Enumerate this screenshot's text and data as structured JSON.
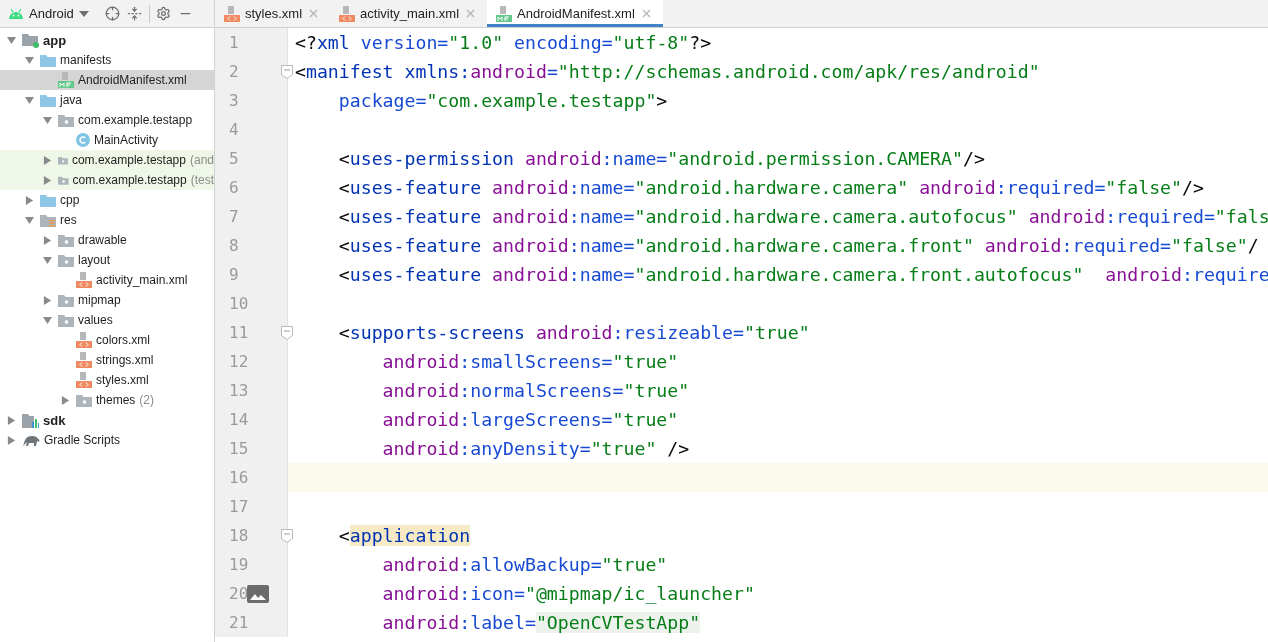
{
  "project_panel": {
    "view": {
      "label": "Android"
    },
    "items": [
      {
        "label": "app",
        "kind": "module",
        "bold": true,
        "expanded": true,
        "selected": false,
        "tinted": false,
        "children": [
          {
            "label": "manifests",
            "kind": "folder",
            "expanded": true,
            "selected": false,
            "tinted": false,
            "children": [
              {
                "label": "AndroidManifest.xml",
                "kind": "manifest",
                "selected": true,
                "tinted": false
              }
            ]
          },
          {
            "label": "java",
            "kind": "folder",
            "expanded": true,
            "selected": false,
            "tinted": false,
            "children": [
              {
                "label": "com.example.testapp",
                "kind": "package",
                "expanded": true,
                "selected": false,
                "tinted": false,
                "children": [
                  {
                    "label": "MainActivity",
                    "kind": "class",
                    "selected": false,
                    "tinted": false
                  }
                ]
              },
              {
                "label": "com.example.testapp",
                "suffix": "(and",
                "kind": "package",
                "expanded": false,
                "selected": false,
                "tinted": true
              },
              {
                "label": "com.example.testapp",
                "suffix": "(test",
                "kind": "package",
                "expanded": false,
                "selected": false,
                "tinted": true
              }
            ]
          },
          {
            "label": "cpp",
            "kind": "folder",
            "expanded": false,
            "selected": false,
            "tinted": false
          },
          {
            "label": "res",
            "kind": "res",
            "expanded": true,
            "selected": false,
            "tinted": false,
            "children": [
              {
                "label": "drawable",
                "kind": "package",
                "expanded": false,
                "selected": false,
                "tinted": false
              },
              {
                "label": "layout",
                "kind": "package",
                "expanded": true,
                "selected": false,
                "tinted": false,
                "children": [
                  {
                    "label": "activity_main.xml",
                    "kind": "xml",
                    "selected": false,
                    "tinted": false
                  }
                ]
              },
              {
                "label": "mipmap",
                "kind": "package",
                "expanded": false,
                "selected": false,
                "tinted": false
              },
              {
                "label": "values",
                "kind": "package",
                "expanded": true,
                "selected": false,
                "tinted": false,
                "children": [
                  {
                    "label": "colors.xml",
                    "kind": "xml",
                    "selected": false,
                    "tinted": false
                  },
                  {
                    "label": "strings.xml",
                    "kind": "xml",
                    "selected": false,
                    "tinted": false
                  },
                  {
                    "label": "styles.xml",
                    "kind": "xml",
                    "selected": false,
                    "tinted": false
                  },
                  {
                    "label": "themes",
                    "suffix": "(2)",
                    "kind": "package",
                    "expanded": false,
                    "selected": false,
                    "tinted": false
                  }
                ]
              }
            ]
          }
        ]
      },
      {
        "label": "sdk",
        "kind": "sdk",
        "bold": true,
        "expanded": false,
        "selected": false,
        "tinted": false
      },
      {
        "label": "Gradle Scripts",
        "kind": "gradle",
        "expanded": false,
        "selected": false,
        "tinted": false
      }
    ]
  },
  "tabs": [
    {
      "label": "styles.xml",
      "kind": "xml",
      "selected": false
    },
    {
      "label": "activity_main.xml",
      "kind": "xml",
      "selected": false
    },
    {
      "label": "AndroidManifest.xml",
      "kind": "manifest",
      "selected": true
    }
  ],
  "editor": {
    "lines": [
      {
        "number": "1",
        "kind": "plain",
        "tokens": [
          {
            "kind": "punct",
            "text": "<?"
          },
          {
            "kind": "tag",
            "text": "xml"
          },
          {
            "kind": "attr",
            "text": " version="
          },
          {
            "kind": "value",
            "text": "\"1.0\""
          },
          {
            "kind": "attr",
            "text": " encoding="
          },
          {
            "kind": "value",
            "text": "\"utf-8\""
          },
          {
            "kind": "punct",
            "text": "?>"
          }
        ]
      },
      {
        "number": "2",
        "kind": "fold",
        "tokens": [
          {
            "kind": "punct",
            "text": "<"
          },
          {
            "kind": "tag",
            "text": "manifest"
          },
          {
            "kind": "tag",
            "text": " xmlns:"
          },
          {
            "kind": "ns",
            "text": "android"
          },
          {
            "kind": "attr",
            "text": "="
          },
          {
            "kind": "value",
            "text": "\"http://schemas.android.com/apk/res/android\""
          }
        ]
      },
      {
        "number": "3",
        "kind": "plain",
        "tokens": [
          {
            "kind": "attr",
            "text": "    package="
          },
          {
            "kind": "value",
            "text": "\"com.example.testapp\""
          },
          {
            "kind": "punct",
            "text": ">"
          }
        ]
      },
      {
        "number": "4",
        "kind": "plain"
      },
      {
        "number": "5",
        "kind": "plain",
        "tokens": [
          {
            "kind": "punct",
            "text": "    <"
          },
          {
            "kind": "tag",
            "text": "uses-permission"
          },
          {
            "kind": "ns",
            "text": " android"
          },
          {
            "kind": "attr",
            "text": ":name="
          },
          {
            "kind": "value",
            "text": "\"android.permission.CAMERA\""
          },
          {
            "kind": "punct",
            "text": "/>"
          }
        ]
      },
      {
        "number": "6",
        "kind": "plain",
        "tokens": [
          {
            "kind": "punct",
            "text": "    <"
          },
          {
            "kind": "tag",
            "text": "uses-feature"
          },
          {
            "kind": "ns",
            "text": " android"
          },
          {
            "kind": "attr",
            "text": ":name="
          },
          {
            "kind": "value",
            "text": "\"android.hardware.camera\""
          },
          {
            "kind": "ns",
            "text": " android"
          },
          {
            "kind": "attr",
            "text": ":required="
          },
          {
            "kind": "value",
            "text": "\"false\""
          },
          {
            "kind": "punct",
            "text": "/>"
          }
        ]
      },
      {
        "number": "7",
        "kind": "plain",
        "tokens": [
          {
            "kind": "punct",
            "text": "    <"
          },
          {
            "kind": "tag",
            "text": "uses-feature"
          },
          {
            "kind": "ns",
            "text": " android"
          },
          {
            "kind": "attr",
            "text": ":name="
          },
          {
            "kind": "value",
            "text": "\"android.hardware.camera.autofocus\""
          },
          {
            "kind": "ns",
            "text": " android"
          },
          {
            "kind": "attr",
            "text": ":required="
          },
          {
            "kind": "value",
            "text": "\"fals"
          }
        ]
      },
      {
        "number": "8",
        "kind": "plain",
        "tokens": [
          {
            "kind": "punct",
            "text": "    <"
          },
          {
            "kind": "tag",
            "text": "uses-feature"
          },
          {
            "kind": "ns",
            "text": " android"
          },
          {
            "kind": "attr",
            "text": ":name="
          },
          {
            "kind": "value",
            "text": "\"android.hardware.camera.front\""
          },
          {
            "kind": "ns",
            "text": " android"
          },
          {
            "kind": "attr",
            "text": ":required="
          },
          {
            "kind": "value",
            "text": "\"false\""
          },
          {
            "kind": "punct",
            "text": "/"
          }
        ]
      },
      {
        "number": "9",
        "kind": "plain",
        "tokens": [
          {
            "kind": "punct",
            "text": "    <"
          },
          {
            "kind": "tag",
            "text": "uses-feature"
          },
          {
            "kind": "ns",
            "text": " android"
          },
          {
            "kind": "attr",
            "text": ":name="
          },
          {
            "kind": "value",
            "text": "\"android.hardware.camera.front.autofocus\""
          },
          {
            "kind": "ns",
            "text": "  android"
          },
          {
            "kind": "attr",
            "text": ":require"
          }
        ]
      },
      {
        "number": "10",
        "kind": "plain"
      },
      {
        "number": "11",
        "kind": "fold",
        "tokens": [
          {
            "kind": "punct",
            "text": "    <"
          },
          {
            "kind": "tag",
            "text": "supports-screens"
          },
          {
            "kind": "ns",
            "text": " android"
          },
          {
            "kind": "attr",
            "text": ":resizeable="
          },
          {
            "kind": "value",
            "text": "\"true\""
          }
        ]
      },
      {
        "number": "12",
        "kind": "plain",
        "tokens": [
          {
            "kind": "ns",
            "text": "        android"
          },
          {
            "kind": "attr",
            "text": ":smallScreens="
          },
          {
            "kind": "value",
            "text": "\"true\""
          }
        ]
      },
      {
        "number": "13",
        "kind": "plain",
        "tokens": [
          {
            "kind": "ns",
            "text": "        android"
          },
          {
            "kind": "attr",
            "text": ":normalScreens="
          },
          {
            "kind": "value",
            "text": "\"true\""
          }
        ]
      },
      {
        "number": "14",
        "kind": "plain",
        "tokens": [
          {
            "kind": "ns",
            "text": "        android"
          },
          {
            "kind": "attr",
            "text": ":largeScreens="
          },
          {
            "kind": "value",
            "text": "\"true\""
          }
        ]
      },
      {
        "number": "15",
        "kind": "plain",
        "tokens": [
          {
            "kind": "ns",
            "text": "        android"
          },
          {
            "kind": "attr",
            "text": ":anyDensity="
          },
          {
            "kind": "value",
            "text": "\"true\""
          },
          {
            "kind": "punct",
            "text": " />"
          }
        ]
      },
      {
        "number": "16",
        "kind": "plain",
        "current": true
      },
      {
        "number": "17",
        "kind": "plain"
      },
      {
        "number": "18",
        "kind": "fold",
        "tokens": [
          {
            "kind": "punct",
            "text": "    <"
          },
          {
            "kind": "tag",
            "text": "application",
            "highlighted": true
          }
        ]
      },
      {
        "number": "19",
        "kind": "plain",
        "tokens": [
          {
            "kind": "ns",
            "text": "        android"
          },
          {
            "kind": "attr",
            "text": ":allowBackup="
          },
          {
            "kind": "value",
            "text": "\"true\""
          }
        ]
      },
      {
        "number": "20",
        "kind": "image",
        "tokens": [
          {
            "kind": "ns",
            "text": "        android"
          },
          {
            "kind": "attr",
            "text": ":icon="
          },
          {
            "kind": "value",
            "text": "\"@mipmap/ic_launcher\""
          }
        ]
      },
      {
        "number": "21",
        "kind": "plain",
        "tokens": [
          {
            "kind": "ns",
            "text": "        android"
          },
          {
            "kind": "attr",
            "text": ":label="
          },
          {
            "kind": "value",
            "text": "\"OpenCVTestApp\"",
            "highlighted": true
          }
        ]
      }
    ]
  }
}
